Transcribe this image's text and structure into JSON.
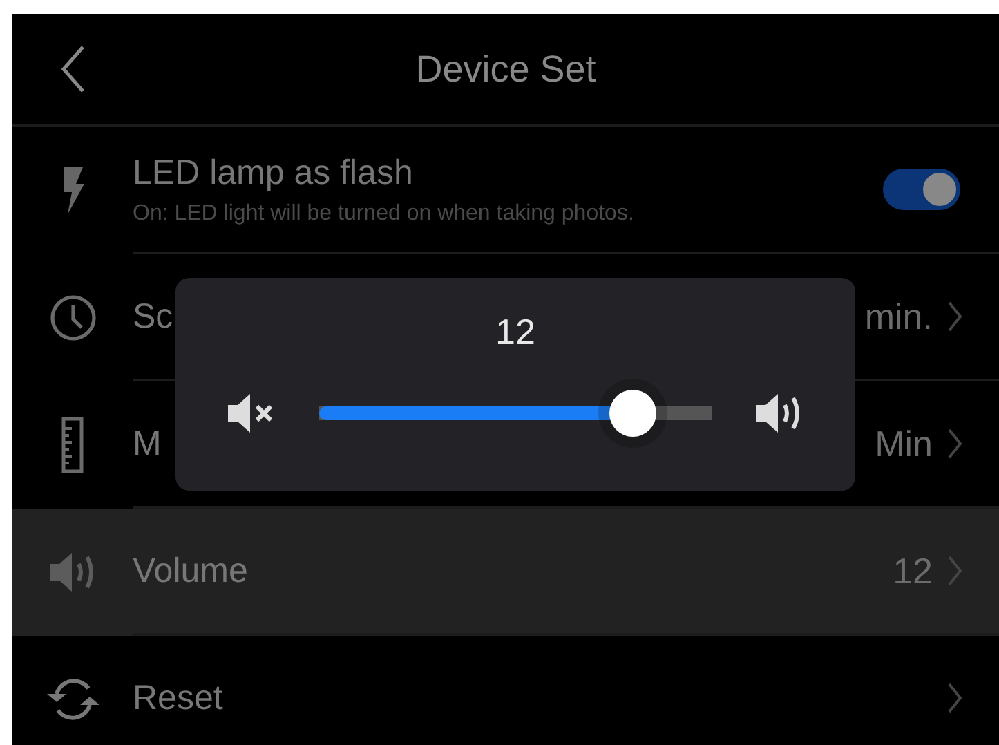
{
  "header": {
    "title": "Device Set"
  },
  "settings": [
    {
      "kind": "toggle",
      "label": "LED lamp as flash",
      "description": "On: LED light will be turned on when taking photos.",
      "on": true,
      "selected": false
    },
    {
      "kind": "link",
      "label": "Sc",
      "value": "min.",
      "selected": false
    },
    {
      "kind": "link",
      "label": "M",
      "value": "Min",
      "selected": false
    },
    {
      "kind": "link",
      "label": "Volume",
      "value": "12",
      "selected": true
    },
    {
      "kind": "link",
      "label": "Reset",
      "selected": false
    }
  ],
  "volume_popup": {
    "reading": "12",
    "level": 0.8
  }
}
